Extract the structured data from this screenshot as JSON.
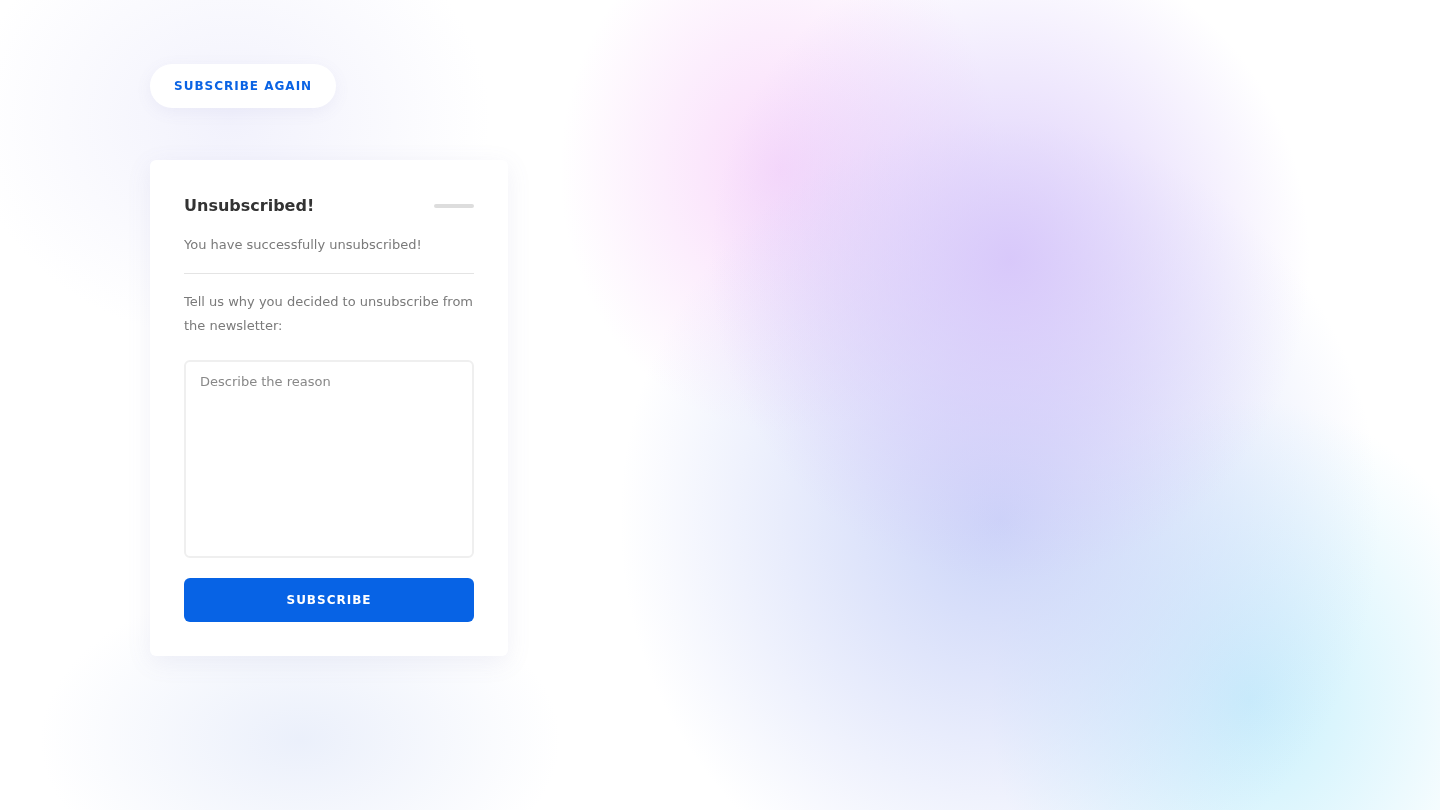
{
  "top_button": {
    "label": "SUBSCRIBE AGAIN"
  },
  "card": {
    "title": "Unsubscribed!",
    "message": "You have successfully unsubscribed!",
    "prompt": "Tell us why you decided to unsubscribe from the newsletter:",
    "reason_field": {
      "placeholder": "Describe the reason"
    },
    "submit_button": {
      "label": "SUBSCRIBE"
    }
  }
}
